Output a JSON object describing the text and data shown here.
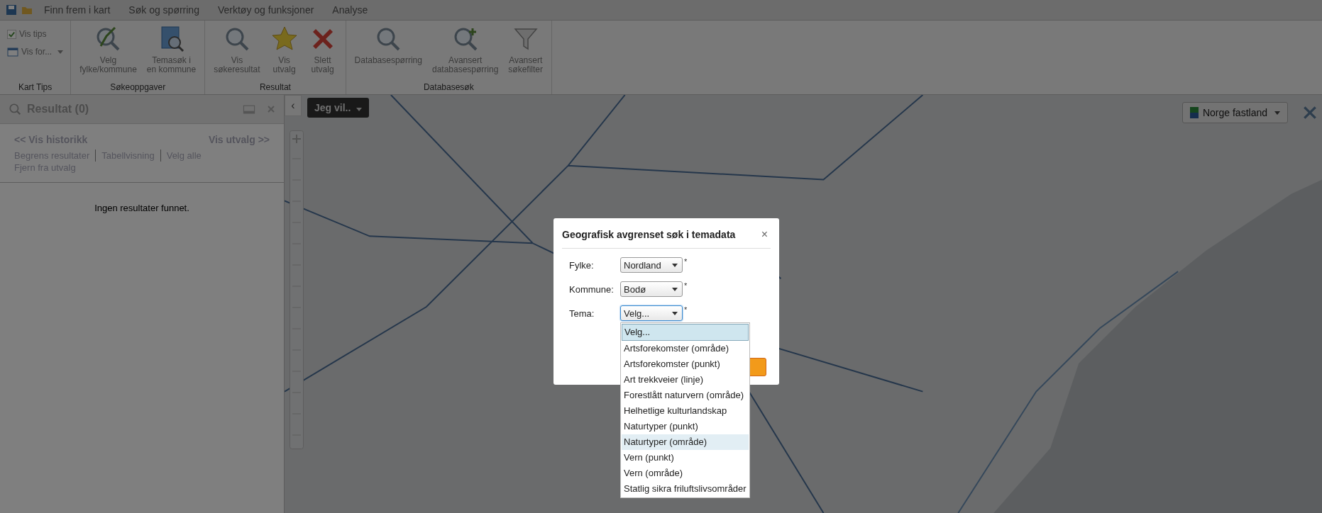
{
  "menu_bar": {
    "items": [
      "Finn frem i kart",
      "Søk og spørring",
      "Verktøy og funksjoner",
      "Analyse"
    ]
  },
  "ribbon": {
    "groups": [
      {
        "label": "Kart Tips",
        "small_buttons": [
          {
            "label": "Vis tips",
            "kind": "check",
            "checked": true
          },
          {
            "label": "Vis for...",
            "kind": "dropdown"
          }
        ]
      },
      {
        "label": "Søkeoppgaver",
        "buttons": [
          "Velg\nfylke/kommune",
          "Temasøk i\nen kommune"
        ]
      },
      {
        "label": "Resultat",
        "buttons": [
          "Vis\nsøkeresultat",
          "Vis\nutvalg",
          "Slett\nutvalg"
        ]
      },
      {
        "label": "Databasesøk",
        "buttons": [
          "Databasespørring",
          "Avansert\ndatabasespørring",
          "Avansert\nsøkefilter"
        ]
      }
    ]
  },
  "result_panel": {
    "title": "Resultat (0)",
    "history_link": "<< Vis historikk",
    "selection_link": "Vis utvalg >>",
    "action_rows": [
      [
        "Begrens resultater",
        "Tabellvisning",
        "Velg alle"
      ],
      [
        "Fjern fra utvalg"
      ]
    ],
    "empty_message": "Ingen resultater funnet."
  },
  "map": {
    "collapse_button": "‹",
    "menu_button": "Jeg vil..",
    "region_selector": "Norge fastland"
  },
  "dialog": {
    "title": "Geografisk avgrenset søk i temadata",
    "close": "×",
    "fields": [
      {
        "label": "Fylke:",
        "value": "Nordland",
        "required_mark": "*",
        "focused": false
      },
      {
        "label": "Kommune:",
        "value": "Bodø",
        "required_mark": "*",
        "focused": false
      },
      {
        "label": "Tema:",
        "value": "Velg...",
        "required_mark": "*",
        "focused": true
      }
    ],
    "options": [
      {
        "label": "Velg...",
        "selected": true,
        "hovered": false
      },
      {
        "label": "Artsforekomster (område)",
        "selected": false,
        "hovered": false
      },
      {
        "label": "Artsforekomster (punkt)",
        "selected": false,
        "hovered": false
      },
      {
        "label": "Art trekkveier (linje)",
        "selected": false,
        "hovered": false
      },
      {
        "label": "Forestlått naturvern (område)",
        "selected": false,
        "hovered": false
      },
      {
        "label": "Helhetlige kulturlandskap",
        "selected": false,
        "hovered": false
      },
      {
        "label": "Naturtyper (punkt)",
        "selected": false,
        "hovered": false
      },
      {
        "label": "Naturtyper (område)",
        "selected": false,
        "hovered": true
      },
      {
        "label": "Vern (punkt)",
        "selected": false,
        "hovered": false
      },
      {
        "label": "Vern (område)",
        "selected": false,
        "hovered": false
      },
      {
        "label": "Statlig sikra friluftslivsområder",
        "selected": false,
        "hovered": false
      }
    ]
  }
}
